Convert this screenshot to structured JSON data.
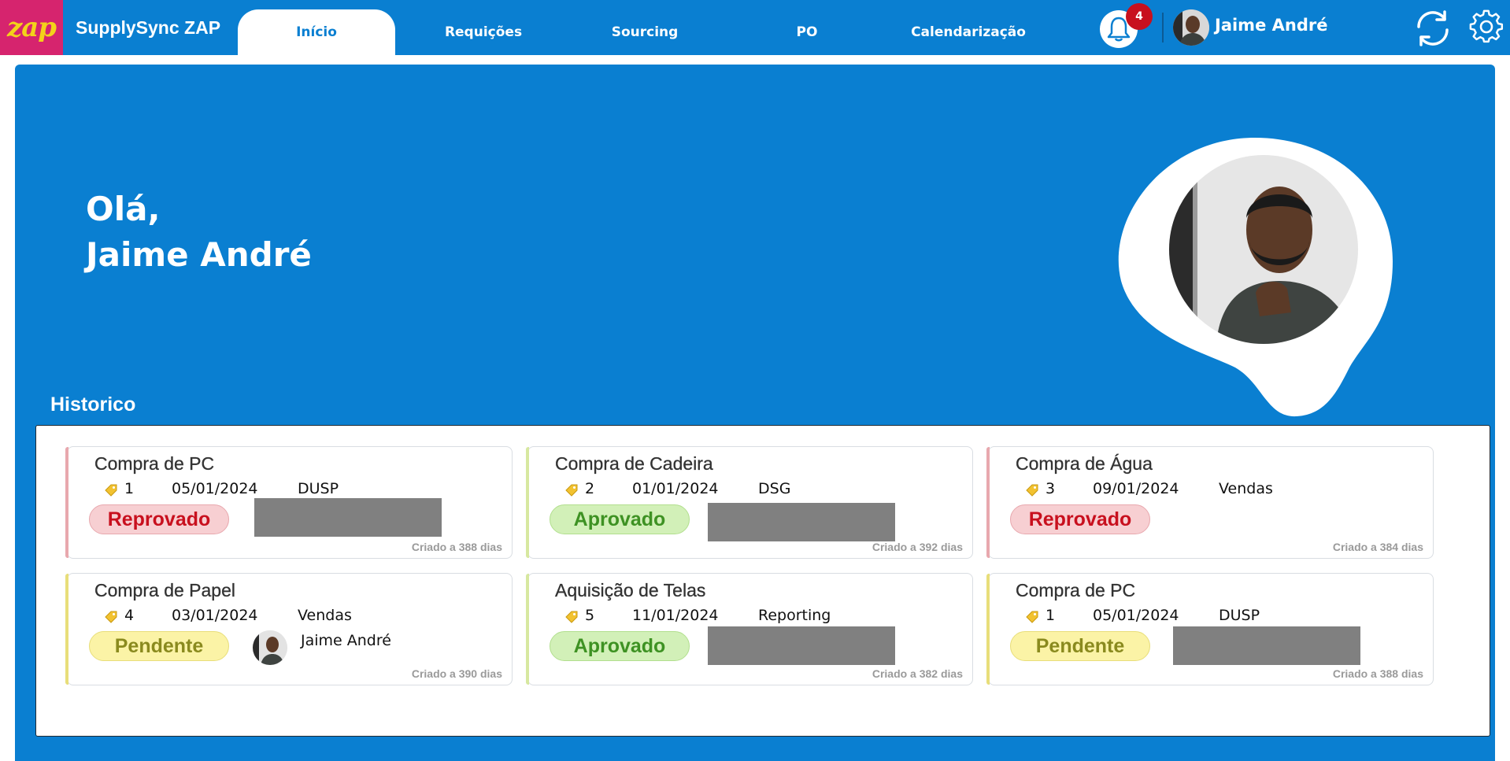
{
  "app": {
    "logo_text": "zap",
    "title": "SupplySync ZAP"
  },
  "nav": {
    "tabs": [
      {
        "label": "Início",
        "active": true
      },
      {
        "label": "Requições",
        "active": false
      },
      {
        "label": "Sourcing",
        "active": false
      },
      {
        "label": "PO",
        "active": false
      },
      {
        "label": "Calendarização",
        "active": false
      }
    ]
  },
  "header": {
    "notification_count": "4",
    "user_name": "Jaime André"
  },
  "hero": {
    "greeting_line1": "Olá,",
    "greeting_line2": "Jaime André"
  },
  "history": {
    "title": "Historico",
    "cards": [
      {
        "title": "Compra de PC",
        "number": "1",
        "date": "05/01/2024",
        "department": "DUSP",
        "status": "Reprovado",
        "status_type": "rejected",
        "assignee": "",
        "created": "Criado a 388 dias"
      },
      {
        "title": "Compra de Cadeira",
        "number": "2",
        "date": "01/01/2024",
        "department": "DSG",
        "status": "Aprovado",
        "status_type": "approved",
        "assignee": "",
        "created": "Criado a 392 dias"
      },
      {
        "title": "Compra de Água",
        "number": "3",
        "date": "09/01/2024",
        "department": "Vendas",
        "status": "Reprovado",
        "status_type": "rejected",
        "assignee": "",
        "created": "Criado a 384 dias"
      },
      {
        "title": "Compra de Papel",
        "number": "4",
        "date": "03/01/2024",
        "department": "Vendas",
        "status": "Pendente",
        "status_type": "pending",
        "assignee": "Jaime André",
        "created": "Criado a 390 dias"
      },
      {
        "title": "Aquisição de Telas",
        "number": "5",
        "date": "11/01/2024",
        "department": "Reporting",
        "status": "Aprovado",
        "status_type": "approved",
        "assignee": "",
        "created": "Criado a 382 dias"
      },
      {
        "title": "Compra de PC",
        "number": "1",
        "date": "05/01/2024",
        "department": "DUSP",
        "status": "Pendente",
        "status_type": "pending",
        "assignee": "",
        "created": "Criado a 388 dias"
      }
    ]
  },
  "colors": {
    "brand_blue": "#0a7fd1",
    "logo_bg": "#d6246e",
    "logo_text": "#f3d21a",
    "badge_red": "#c8101e",
    "rejected_text": "#c8101e",
    "approved_text": "#3e9223",
    "pending_text": "#8a8a1e"
  },
  "icons": [
    "bell-icon",
    "sync-icon",
    "gear-icon",
    "tag-icon"
  ]
}
